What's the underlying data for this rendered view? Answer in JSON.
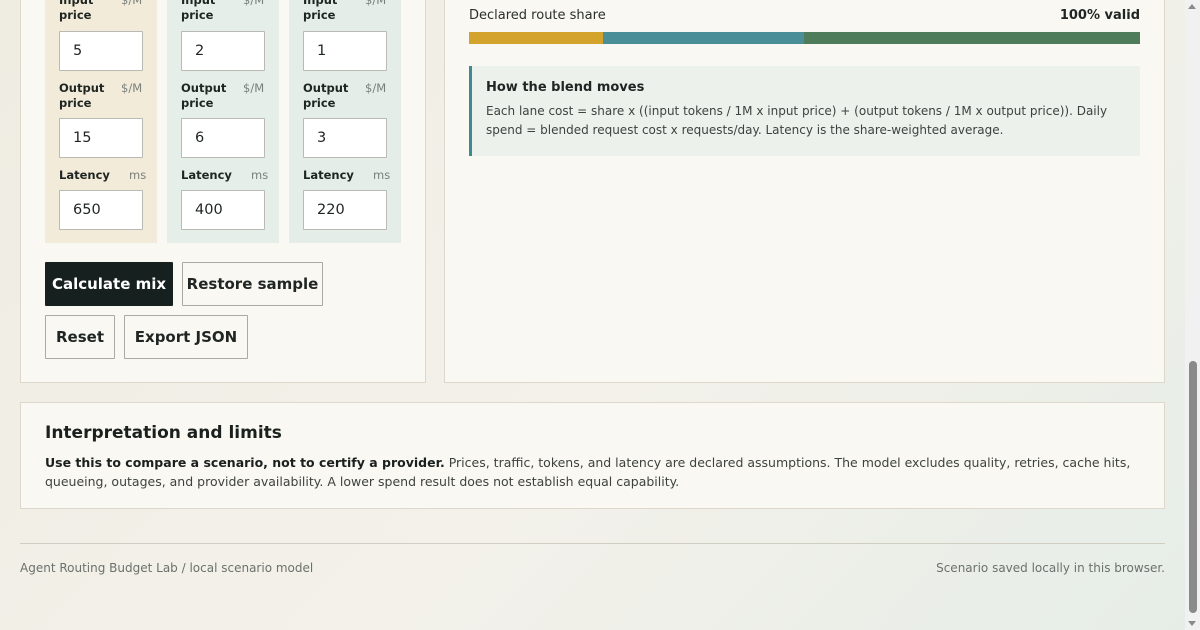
{
  "lanes": [
    {
      "input_price_label": "Input price",
      "input_price_unit": "$/M",
      "input_price_value": "5",
      "output_price_label": "Output price",
      "output_price_unit": "$/M",
      "output_price_value": "15",
      "latency_label": "Latency",
      "latency_unit": "ms",
      "latency_value": "650"
    },
    {
      "input_price_label": "Input price",
      "input_price_unit": "$/M",
      "input_price_value": "2",
      "output_price_label": "Output price",
      "output_price_unit": "$/M",
      "output_price_value": "6",
      "latency_label": "Latency",
      "latency_unit": "ms",
      "latency_value": "400"
    },
    {
      "input_price_label": "Input price",
      "input_price_unit": "$/M",
      "input_price_value": "1",
      "output_price_label": "Output price",
      "output_price_unit": "$/M",
      "output_price_value": "3",
      "latency_label": "Latency",
      "latency_unit": "ms",
      "latency_value": "220"
    }
  ],
  "actions": {
    "calculate": "Calculate mix",
    "restore": "Restore sample",
    "reset": "Reset",
    "export": "Export JSON"
  },
  "route_share": {
    "label": "Declared route share",
    "status": "100% valid",
    "segments": [
      {
        "share": 0.2,
        "color": "#d4a32b"
      },
      {
        "share": 0.3,
        "color": "#4a8f98"
      },
      {
        "share": 0.5,
        "color": "#4f7d5c"
      }
    ]
  },
  "blend": {
    "title": "How the blend moves",
    "text": "Each lane cost = share x ((input tokens / 1M x input price) + (output tokens / 1M x output price)). Daily spend = blended request cost x requests/day. Latency is the share-weighted average."
  },
  "limits": {
    "title": "Interpretation and limits",
    "lead": "Use this to compare a scenario, not to certify a provider.",
    "text": "Prices, traffic, tokens, and latency are declared assumptions. The model excludes quality, retries, cache hits, queueing, outages, and provider availability. A lower spend result does not establish equal capability."
  },
  "footer": {
    "left": "Agent Routing Budget Lab / local scenario model",
    "right": "Scenario saved locally in this browser."
  },
  "colors": {
    "lane_1_bg": "#f2ebd9",
    "lane_2_bg": "#e6eeea",
    "lane_3_bg": "#e4ede8",
    "primary_button": "#16211f",
    "blend_accent": "#3e8a8e"
  }
}
